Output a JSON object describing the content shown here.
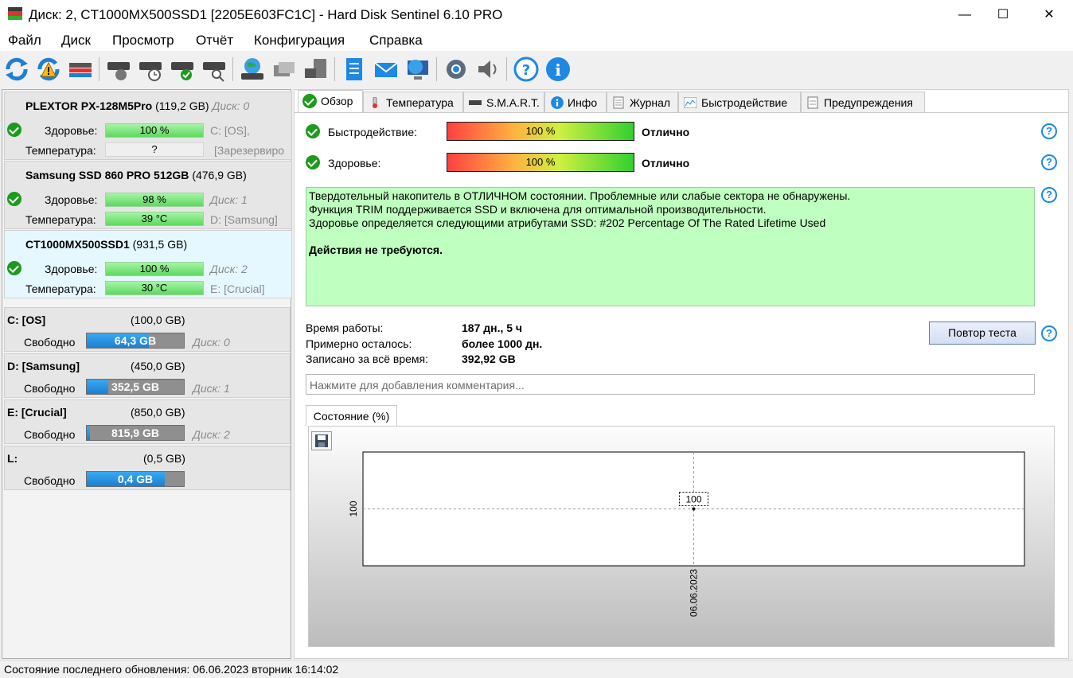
{
  "window": {
    "title": "Диск: 2, CT1000MX500SSD1 [2205E603FC1C]  -  Hard Disk Sentinel 6.10 PRO",
    "minimize": "—",
    "maximize": "☐",
    "close": "✕"
  },
  "menu": [
    "Файл",
    "Диск",
    "Просмотр",
    "Отчёт",
    "Конфигурация",
    "Справка"
  ],
  "toolbar_icons": [
    "refresh-icon",
    "refresh-warning-icon",
    "disk-list-icon",
    "disk-surface-icon",
    "disk-schedule-icon",
    "disk-check-icon",
    "disk-search-icon",
    "globe-disk-icon",
    "network-icon",
    "disk-export-icon",
    "report-icon",
    "email-icon",
    "web-icon",
    "settings-icon",
    "sound-icon",
    "help-icon",
    "info-icon"
  ],
  "disks": [
    {
      "name": "PLEXTOR PX-128M5Pro",
      "size": "(119,2 GB)",
      "disk": "Диск: 0",
      "health_label": "Здоровье:",
      "health": "100 %",
      "temp_label": "Температура:",
      "temp": "?",
      "vol1": "C: [OS],",
      "vol2": "[Зарезервиро"
    },
    {
      "name": "Samsung SSD 860 PRO 512GB",
      "size": "(476,9 GB)",
      "disk": "",
      "health_label": "Здоровье:",
      "health": "98 %",
      "temp_label": "Температура:",
      "temp": "39 °C",
      "vol1": "Диск: 1",
      "vol2": "D: [Samsung]"
    },
    {
      "name": "CT1000MX500SSD1",
      "size": "(931,5 GB)",
      "disk": "",
      "health_label": "Здоровье:",
      "health": "100 %",
      "temp_label": "Температура:",
      "temp": "30 °C",
      "vol1": "Диск: 2",
      "vol2": "E: [Crucial]"
    }
  ],
  "volumes": [
    {
      "name": "C: [OS]",
      "size": "(100,0 GB)",
      "free_label": "Свободно",
      "free": "64,3 GB",
      "disk": "Диск: 0",
      "free_pct": 64
    },
    {
      "name": "D: [Samsung]",
      "size": "(450,0 GB)",
      "free_label": "Свободно",
      "free": "352,5 GB",
      "disk": "Диск: 1",
      "free_pct": 22
    },
    {
      "name": "E: [Crucial]",
      "size": "(850,0 GB)",
      "free_label": "Свободно",
      "free": "815,9 GB",
      "disk": "Диск: 2",
      "free_pct": 3
    },
    {
      "name": "L:",
      "size": "(0,5 GB)",
      "free_label": "Свободно",
      "free": "0,4 GB",
      "disk": "",
      "free_pct": 80
    }
  ],
  "tabs": [
    "Обзор",
    "Температура",
    "S.M.A.R.T.",
    "Инфо",
    "Журнал",
    "Быстродействие",
    "Предупреждения"
  ],
  "overview": {
    "perf_label": "Быстродействие:",
    "perf_value": "100 %",
    "perf_text": "Отлично",
    "health_label": "Здоровье:",
    "health_value": "100 %",
    "health_text": "Отлично",
    "info_lines": [
      "Твердотельный накопитель в ОТЛИЧНОМ состоянии. Проблемные или слабые сектора не обнаружены.",
      "Функция TRIM поддерживается SSD и включена для оптимальной производительности.",
      "Здоровье определяется следующими атрибутами SSD: #202 Percentage Of The Rated Lifetime Used"
    ],
    "action": "Действия не требуются.",
    "uptime_label": "Время работы:",
    "uptime": "187 дн., 5 ч",
    "remaining_label": "Примерно осталось:",
    "remaining": "более 1000 дн.",
    "written_label": "Записано за всё время:",
    "written": "392,92 GB",
    "retest_button": "Повтор теста",
    "comment_placeholder": "Нажмите для добавления комментария..."
  },
  "graph": {
    "tab_label": "Состояние (%)"
  },
  "chart_data": {
    "type": "line",
    "x": [
      "06.06.2023"
    ],
    "y": [
      100
    ],
    "ytick": "100",
    "point_label": "100"
  },
  "status": "Состояние последнего обновления: 06.06.2023 вторник 16:14:02"
}
